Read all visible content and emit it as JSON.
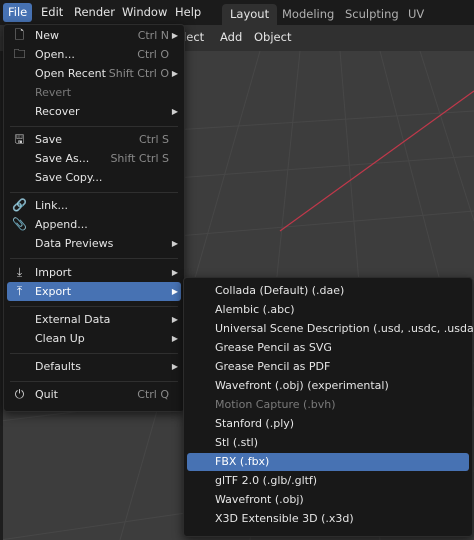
{
  "topbar": {
    "menus": [
      "File",
      "Edit",
      "Render",
      "Window",
      "Help"
    ],
    "tabs": [
      "Layout",
      "Modeling",
      "Sculpting",
      "UV Editing"
    ]
  },
  "viewport_header": {
    "items": [
      "elect",
      "Add",
      "Object"
    ]
  },
  "file_menu": {
    "items": [
      {
        "label": "New",
        "shortcut": "Ctrl N",
        "icon": "new-file-icon"
      },
      {
        "label": "Open...",
        "shortcut": "Ctrl O",
        "icon": "folder-icon"
      },
      {
        "label": "Open Recent",
        "shortcut": "Shift Ctrl O"
      },
      {
        "label": "Revert"
      },
      {
        "label": "Recover"
      },
      {
        "label": "Save",
        "shortcut": "Ctrl S",
        "icon": "save-icon"
      },
      {
        "label": "Save As...",
        "shortcut": "Shift Ctrl S"
      },
      {
        "label": "Save Copy..."
      },
      {
        "label": "Link...",
        "icon": "link-icon"
      },
      {
        "label": "Append...",
        "icon": "append-icon"
      },
      {
        "label": "Data Previews"
      },
      {
        "label": "Import",
        "icon": "import-icon"
      },
      {
        "label": "Export",
        "icon": "export-icon"
      },
      {
        "label": "External Data"
      },
      {
        "label": "Clean Up"
      },
      {
        "label": "Defaults"
      },
      {
        "label": "Quit",
        "shortcut": "Ctrl Q",
        "icon": "power-icon"
      }
    ]
  },
  "export_menu": {
    "items": [
      "Collada (Default) (.dae)",
      "Alembic (.abc)",
      "Universal Scene Description (.usd, .usdc, .usda)",
      "Grease Pencil as SVG",
      "Grease Pencil as PDF",
      "Wavefront (.obj) (experimental)",
      "Motion Capture (.bvh)",
      "Stanford (.ply)",
      "Stl (.stl)",
      "FBX (.fbx)",
      "glTF 2.0 (.glb/.gltf)",
      "Wavefront (.obj)",
      "X3D Extensible 3D (.x3d)"
    ],
    "highlighted": "FBX (.fbx)",
    "disabled": "Motion Capture (.bvh)"
  },
  "colors": {
    "accent": "#4772b3",
    "menu_bg": "#181818",
    "topbar_bg": "#1b1b1b",
    "viewport_bg": "#3d3d3d",
    "grid_line": "#474747",
    "x_axis": "#c0384a"
  }
}
